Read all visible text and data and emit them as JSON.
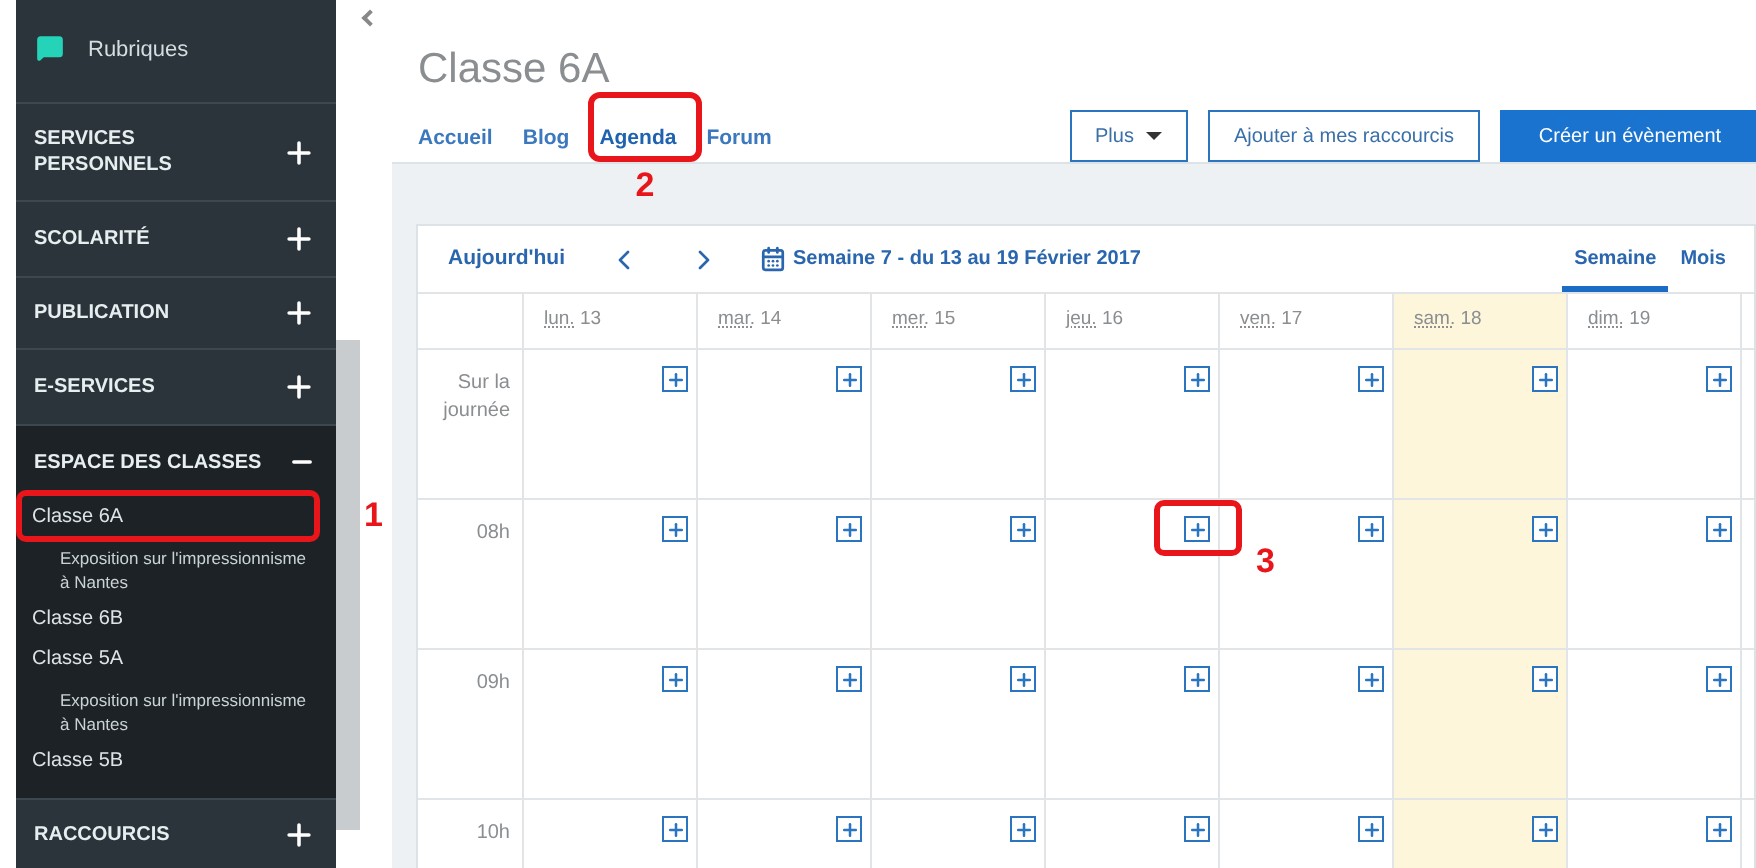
{
  "sidebar": {
    "top_item": {
      "label": "Rubriques"
    },
    "sections": [
      {
        "label": "SERVICES PERSONNELS",
        "expanded": false
      },
      {
        "label": "SCOLARITÉ",
        "expanded": false
      },
      {
        "label": "PUBLICATION",
        "expanded": false
      },
      {
        "label": "E-SERVICES",
        "expanded": false
      },
      {
        "label": "ESPACE DES CLASSES",
        "expanded": true,
        "children": [
          {
            "label": "Classe 6A",
            "callout": "1",
            "children": [
              {
                "label": "Exposition sur l'impressionnisme à Nantes"
              }
            ]
          },
          {
            "label": "Classe 6B"
          },
          {
            "label": "Classe 5A",
            "children": [
              {
                "label": "Exposition sur l'impressionnisme à Nantes"
              }
            ]
          },
          {
            "label": "Classe 5B"
          }
        ]
      },
      {
        "label": "RACCOURCIS",
        "expanded": false
      }
    ]
  },
  "page": {
    "title": "Classe 6A",
    "nav": [
      {
        "label": "Accueil",
        "selected": false
      },
      {
        "label": "Blog",
        "selected": false
      },
      {
        "label": "Agenda",
        "selected": true,
        "callout": "2"
      },
      {
        "label": "Forum",
        "selected": false
      }
    ],
    "buttons": [
      {
        "label": "Plus",
        "kind": "dropdown"
      },
      {
        "label": "Ajouter à mes raccourcis",
        "kind": "outline"
      },
      {
        "label": "Créer un évènement",
        "kind": "primary"
      }
    ]
  },
  "calendar": {
    "today_button": "Aujourd'hui",
    "week_label": "Semaine 7 - du 13 au 19 Février 2017",
    "views": [
      {
        "label": "Semaine",
        "selected": true
      },
      {
        "label": "Mois",
        "selected": false
      }
    ],
    "days": [
      {
        "abbr": "lun.",
        "date": "13",
        "today": false
      },
      {
        "abbr": "mar.",
        "date": "14",
        "today": false
      },
      {
        "abbr": "mer.",
        "date": "15",
        "today": false
      },
      {
        "abbr": "jeu.",
        "date": "16",
        "today": false
      },
      {
        "abbr": "ven.",
        "date": "17",
        "today": false
      },
      {
        "abbr": "sam.",
        "date": "18",
        "today": true
      },
      {
        "abbr": "dim.",
        "date": "19",
        "today": false
      }
    ],
    "rows": [
      {
        "label": "Sur la journée",
        "cells": [
          {
            "add_button": true
          },
          {
            "add_button": true
          },
          {
            "add_button": true
          },
          {
            "add_button": true
          },
          {
            "add_button": true
          },
          {
            "add_button": true
          },
          {
            "add_button": true
          }
        ]
      },
      {
        "label": "08h",
        "cells": [
          {
            "add_button": true
          },
          {
            "add_button": true
          },
          {
            "add_button": true
          },
          {
            "add_button": true,
            "callout": "3"
          },
          {
            "add_button": true
          },
          {
            "add_button": true
          },
          {
            "add_button": true
          }
        ]
      },
      {
        "label": "09h",
        "cells": [
          {
            "add_button": true
          },
          {
            "add_button": true
          },
          {
            "add_button": true
          },
          {
            "add_button": true
          },
          {
            "add_button": true
          },
          {
            "add_button": true
          },
          {
            "add_button": true
          }
        ]
      },
      {
        "label": "10h",
        "cells": [
          {
            "add_button": true
          },
          {
            "add_button": true
          },
          {
            "add_button": true
          },
          {
            "add_button": true
          },
          {
            "add_button": true
          },
          {
            "add_button": true
          },
          {
            "add_button": true
          }
        ]
      }
    ]
  }
}
